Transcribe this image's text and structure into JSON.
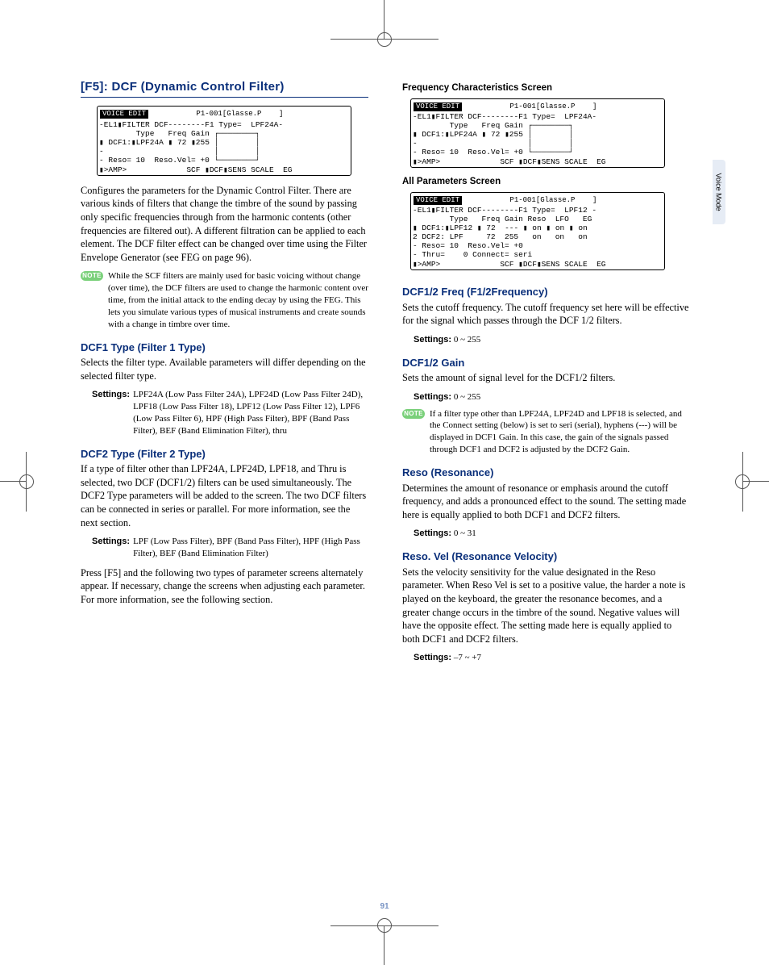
{
  "sideTab": "Voice Mode",
  "pageNumber": "91",
  "sectionTitle": "[F5]: DCF (Dynamic Control Filter)",
  "intro": "Configures the parameters for the Dynamic Control Filter. There are various kinds of filters that change the timbre of the sound by passing only specific frequencies through from the harmonic contents (other frequencies are filtered out). A different filtration can be applied to each element. The DCF filter effect can be changed over time using the Filter Envelope Generator (see FEG on page 96).",
  "note1": "While the SCF filters are mainly used for basic voicing without change (over time), the DCF filters are used to change the harmonic content over time, from the initial attack to the ending decay by using the FEG. This lets you simulate various types of musical instruments and create sounds with a change in timbre over time.",
  "noteBadge": "NOTE",
  "lcd1": {
    "tab": "VOICE EDIT",
    "title": "           P1-001[Glasse.P    ]",
    "line1": "-EL1▮FILTER DCF--------F1 Type=  LPF24A-",
    "line2": "        Type   Freq Gain ┌────────┐",
    "line3": "▮ DCF1:▮LPF24A ▮ 72 ▮255 │        │",
    "line4": "-                        │        │",
    "line5": "- Reso= 10  Reso.Vel= +0 └────────┘",
    "bottom": "▮>AMP>             SCF ▮DCF▮SENS SCALE  EG"
  },
  "dcf1Type": {
    "head": "DCF1 Type (Filter 1 Type)",
    "text": "Selects the filter type. Available parameters will differ depending on the selected filter type.",
    "settingsLabel": "Settings:",
    "settingsVal": "LPF24A (Low Pass Filter 24A), LPF24D (Low Pass Filter 24D), LPF18 (Low Pass Filter 18), LPF12 (Low Pass Filter 12), LPF6 (Low Pass Filter 6), HPF (High Pass Filter), BPF (Band Pass Filter), BEF (Band Elimination Filter), thru"
  },
  "dcf2Type": {
    "head": "DCF2 Type (Filter 2 Type)",
    "text": "If a type of filter other than LPF24A, LPF24D, LPF18, and Thru is selected, two DCF (DCF1/2) filters can be used simultaneously. The DCF2 Type parameters will be added to the screen. The two DCF filters can be connected in series or parallel. For more information, see the next section.",
    "settingsLabel": "Settings:",
    "settingsVal": "LPF (Low Pass Filter), BPF (Band Pass Filter), HPF (High Pass Filter), BEF (Band Elimination Filter)"
  },
  "pressF5": "Press [F5] and the following two types of parameter screens alternately appear. If necessary, change the screens when adjusting each parameter. For more information, see the following section.",
  "freqCaption": "Frequency Characteristics Screen",
  "lcd2": {
    "tab": "VOICE EDIT",
    "title": "           P1-001[Glasse.P    ]",
    "line1": "-EL1▮FILTER DCF--------F1 Type=  LPF24A-",
    "line2": "        Type   Freq Gain ┌────────┐",
    "line3": "▮ DCF1:▮LPF24A ▮ 72 ▮255 │        │",
    "line4": "-                        │        │",
    "line5": "- Reso= 10  Reso.Vel= +0 └────────┘",
    "bottom": "▮>AMP>             SCF ▮DCF▮SENS SCALE  EG"
  },
  "allCaption": "All Parameters Screen",
  "lcd3": {
    "tab": "VOICE EDIT",
    "title": "           P1-001[Glasse.P    ]",
    "line1": "-EL1▮FILTER DCF--------F1 Type=  LPF12 -",
    "line2": "        Type   Freq Gain Reso  LFO   EG",
    "line3": "▮ DCF1:▮LPF12 ▮ 72  --- ▮ on ▮ on ▮ on",
    "line4": "2 DCF2: LPF     72  255   on   on   on",
    "line5": "- Reso= 10  Reso.Vel= +0",
    "line6": "- Thru=    0 Connect= seri",
    "bottom": "▮>AMP>             SCF ▮DCF▮SENS SCALE  EG"
  },
  "freq": {
    "head": "DCF1/2 Freq (F1/2Frequency)",
    "text": "Sets the cutoff frequency. The cutoff frequency set here will be effective for the signal which passes through the DCF 1/2 filters.",
    "settingsLabel": "Settings:",
    "settingsVal": "0 ~ 255"
  },
  "gain": {
    "head": "DCF1/2 Gain",
    "text": "Sets the amount of signal level for the DCF1/2 filters.",
    "settingsLabel": "Settings:",
    "settingsVal": "0 ~ 255"
  },
  "note2": "If a filter type other than LPF24A, LPF24D and LPF18 is selected, and the Connect setting (below) is set to seri (serial), hyphens (---) will be displayed in DCF1 Gain. In this case, the gain of the signals passed through DCF1 and DCF2 is adjusted by the DCF2 Gain.",
  "reso": {
    "head": "Reso (Resonance)",
    "text": "Determines the amount of resonance or emphasis around the cutoff frequency, and adds a pronounced effect to the sound. The setting made here is equally applied to both DCF1 and DCF2 filters.",
    "settingsLabel": "Settings:",
    "settingsVal": "0 ~ 31"
  },
  "resoVel": {
    "head": "Reso. Vel (Resonance Velocity)",
    "text": "Sets the velocity sensitivity for the value designated in the Reso parameter. When Reso Vel is set to a positive value, the harder a note is played on the keyboard, the greater the resonance becomes, and a greater change occurs in the timbre of the sound. Negative values will have the opposite effect. The setting made here is equally applied to both DCF1 and DCF2 filters.",
    "settingsLabel": "Settings:",
    "settingsVal": "–7 ~ +7"
  }
}
